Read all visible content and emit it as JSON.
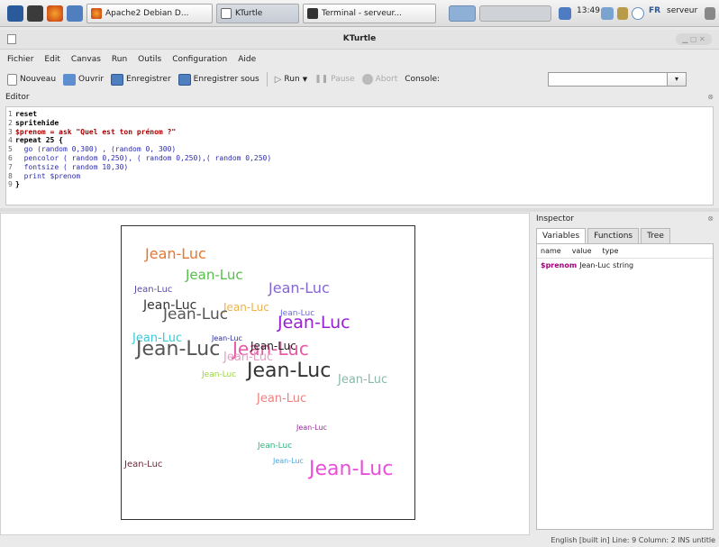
{
  "system_panel": {
    "tasks": [
      {
        "label": "Apache2 Debian D...",
        "icon": "firefox-icon"
      },
      {
        "label": "KTurtle",
        "icon": "window-icon"
      },
      {
        "label": "Terminal - serveur...",
        "icon": "terminal-icon"
      }
    ],
    "clock": "13:49",
    "keyboard_layout": "FR",
    "user": "serveur"
  },
  "window": {
    "title": "KTurtle"
  },
  "menubar": [
    "Fichier",
    "Edit",
    "Canvas",
    "Run",
    "Outils",
    "Configuration",
    "Aide"
  ],
  "toolbar": {
    "new_label": "Nouveau",
    "open_label": "Ouvrir",
    "save_label": "Enregistrer",
    "saveas_label": "Enregistrer sous",
    "run_label": "Run",
    "pause_label": "Pause",
    "abort_label": "Abort",
    "console_label": "Console:",
    "console_value": ""
  },
  "editor": {
    "label": "Editor",
    "lines": [
      "reset",
      "spritehide",
      "$prenom = ask \"Quel est ton prénom ?\"",
      "repeat 25 {",
      "  go (random 0,300) , (random 0, 300)",
      "  pencolor ( random 0,250), ( random 0,250),( random 0,250)",
      "  fontsize ( random 10,30)",
      "  print $prenom",
      "}"
    ]
  },
  "canvas": {
    "printed_text": "Jean-Luc"
  },
  "inspector": {
    "title": "Inspector",
    "tabs": [
      "Variables",
      "Functions",
      "Tree"
    ],
    "columns": [
      "name",
      "value",
      "type"
    ],
    "rows": [
      {
        "name": "$prenom",
        "value": "Jean-Luc",
        "type": "string"
      }
    ]
  },
  "statusbar": "English [built in]   Line: 9 Column: 2   INS   untitle",
  "colors": {
    "keyword": "#000000",
    "variable": "#aa0000",
    "string": "#aa2233",
    "number": "#2f6fbf"
  }
}
